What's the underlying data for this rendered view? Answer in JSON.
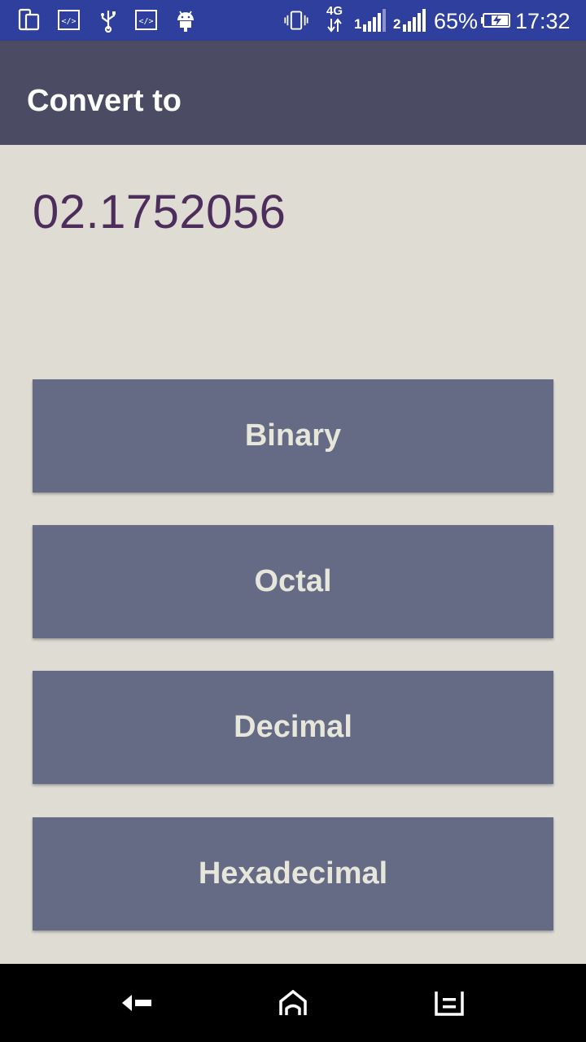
{
  "status_bar": {
    "battery_percent": "65%",
    "time": "17:32",
    "network_type": "4G",
    "sim1_label": "1",
    "sim2_label": "2",
    "icons": [
      "screen-mirror-icon",
      "code-icon",
      "usb-icon",
      "code-icon",
      "android-icon",
      "vibrate-icon",
      "network-4g-icon",
      "signal-sim1-icon",
      "signal-sim2-icon",
      "battery-charging-icon"
    ],
    "bg_color": "#2f3f9e"
  },
  "app_bar": {
    "title": "Convert to",
    "bg_color": "#4b4c63"
  },
  "main": {
    "value": "02.1752056",
    "value_color": "#4d2d5b",
    "buttons": [
      {
        "label": "Binary"
      },
      {
        "label": "Octal"
      },
      {
        "label": "Decimal"
      },
      {
        "label": "Hexadecimal"
      }
    ],
    "button_color": "#666b85",
    "button_text_color": "#e7e6da"
  },
  "nav_bar": {
    "icons": [
      "back-icon",
      "home-icon",
      "recents-icon"
    ]
  }
}
